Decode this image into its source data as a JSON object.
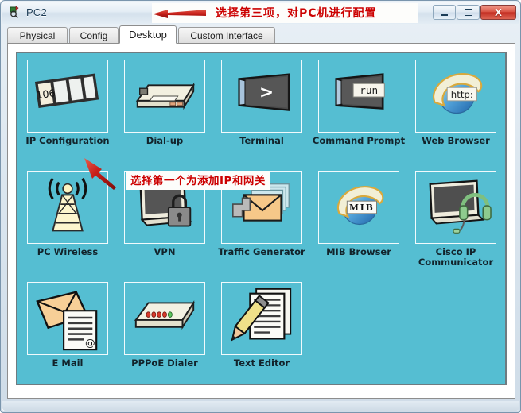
{
  "window": {
    "title": "PC2",
    "icon": "packet-tracer-pc-icon",
    "minimize_label": "Minimize",
    "maximize_label": "Maximize",
    "close_label": "X"
  },
  "tabs": [
    {
      "label": "Physical",
      "active": false
    },
    {
      "label": "Config",
      "active": false
    },
    {
      "label": "Desktop",
      "active": true
    },
    {
      "label": "Custom Interface",
      "active": false
    }
  ],
  "annotations": [
    {
      "id": "title-annotation",
      "text": "选择第三项，对PC机进行配置",
      "color": "#cc0000",
      "arrow": "left-arrow-icon"
    },
    {
      "id": "grid-annotation",
      "text": "选择第一个为添加IP和网关",
      "color": "#cc0000",
      "arrow": "up-left-arrow-icon"
    }
  ],
  "desktop": {
    "background_color": "#55bed2",
    "items": [
      {
        "label": "IP Configuration",
        "icon": "ip-configuration-icon",
        "screen_text": "106"
      },
      {
        "label": "Dial-up",
        "icon": "dialup-modem-icon",
        "screen_text": ""
      },
      {
        "label": "Terminal",
        "icon": "terminal-icon",
        "screen_text": ">"
      },
      {
        "label": "Command Prompt",
        "icon": "command-prompt-icon",
        "screen_text": "run"
      },
      {
        "label": "Web Browser",
        "icon": "web-browser-globe-icon",
        "screen_text": "http:"
      },
      {
        "label": "PC Wireless",
        "icon": "wireless-tower-icon",
        "screen_text": ""
      },
      {
        "label": "VPN",
        "icon": "vpn-monitor-lock-icon",
        "screen_text": ""
      },
      {
        "label": "Traffic Generator",
        "icon": "traffic-generator-envelopes-icon",
        "screen_text": ""
      },
      {
        "label": "MIB Browser",
        "icon": "mib-browser-globe-icon",
        "screen_text": "M I B"
      },
      {
        "label": "Cisco IP Communicator",
        "icon": "monitor-headset-icon",
        "screen_text": ""
      },
      {
        "label": "E Mail",
        "icon": "email-envelope-icon",
        "screen_text": "@"
      },
      {
        "label": "PPPoE Dialer",
        "icon": "pppoe-dialer-icon",
        "screen_text": ""
      },
      {
        "label": "Text Editor",
        "icon": "text-editor-pencil-icon",
        "screen_text": ""
      }
    ]
  }
}
